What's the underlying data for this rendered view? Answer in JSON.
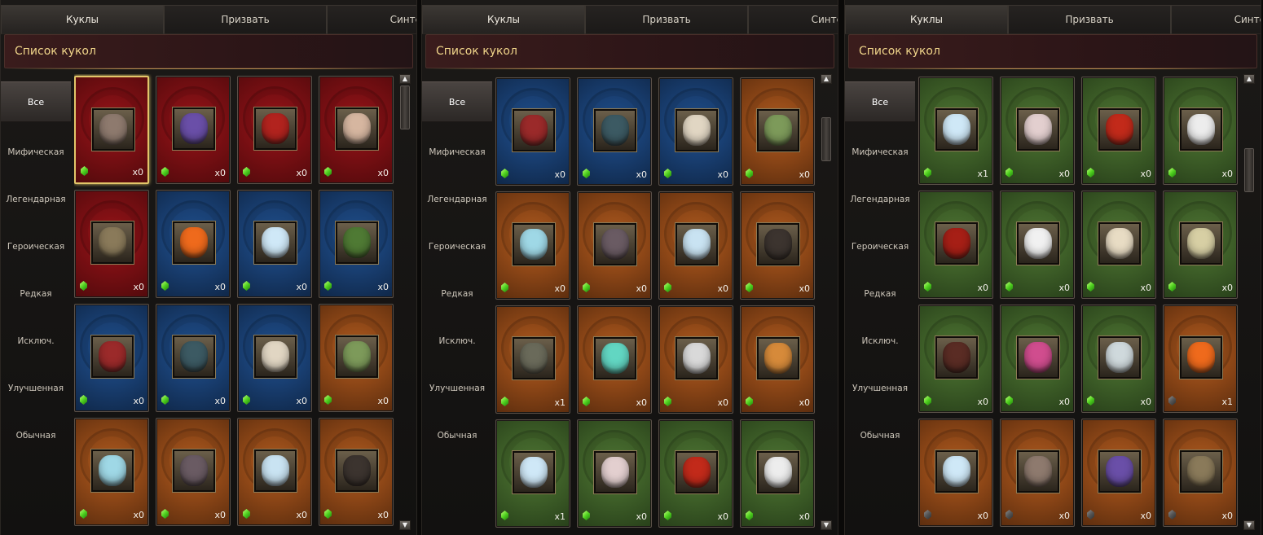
{
  "panels": [
    {
      "tabs": [
        "Куклы",
        "Призвать",
        "Синтез"
      ],
      "active_tab": 0,
      "header": "Список кукол",
      "categories": [
        "Все",
        "Мифическая",
        "Легендарная",
        "Героическая",
        "Редкая",
        "Исключ.",
        "Улучшенная",
        "Обычная"
      ],
      "active_category": 0,
      "scroll_thumb_fraction": 0.0,
      "cards": [
        {
          "rarity": "red",
          "count": "x0",
          "gem": "green",
          "selected": true,
          "face_color": "#8e7a6e"
        },
        {
          "rarity": "red",
          "count": "x0",
          "gem": "green",
          "face_color": "#6a4fa8"
        },
        {
          "rarity": "red",
          "count": "x0",
          "gem": "green",
          "face_color": "#b2231e"
        },
        {
          "rarity": "red",
          "count": "x0",
          "gem": "green",
          "face_color": "#d6b6a0"
        },
        {
          "rarity": "red",
          "count": "x0",
          "gem": "green",
          "face_color": "#8a7a5a"
        },
        {
          "rarity": "blue",
          "count": "x0",
          "gem": "green",
          "face_color": "#ef6a1c"
        },
        {
          "rarity": "blue",
          "count": "x0",
          "gem": "green",
          "face_color": "#cfe8f7"
        },
        {
          "rarity": "blue",
          "count": "x0",
          "gem": "green",
          "face_color": "#4f7a34"
        },
        {
          "rarity": "blue",
          "count": "x0",
          "gem": "green",
          "face_color": "#9b2a2a"
        },
        {
          "rarity": "blue",
          "count": "x0",
          "gem": "green",
          "face_color": "#3c5a63"
        },
        {
          "rarity": "blue",
          "count": "x0",
          "gem": "green",
          "face_color": "#e1d6c3"
        },
        {
          "rarity": "orange",
          "count": "x0",
          "gem": "green",
          "face_color": "#7d9a5a"
        },
        {
          "rarity": "orange",
          "count": "x0",
          "gem": "green",
          "face_color": "#9fd8e6"
        },
        {
          "rarity": "orange",
          "count": "x0",
          "gem": "green",
          "face_color": "#6a5b63"
        },
        {
          "rarity": "orange",
          "count": "x0",
          "gem": "green",
          "face_color": "#c9e3f2"
        },
        {
          "rarity": "orange",
          "count": "x0",
          "gem": "green",
          "face_color": "#3c342f"
        }
      ]
    },
    {
      "tabs": [
        "Куклы",
        "Призвать",
        "Синтез"
      ],
      "active_tab": 0,
      "header": "Список кукол",
      "categories": [
        "Все",
        "Мифическая",
        "Легендарная",
        "Героическая",
        "Редкая",
        "Исключ.",
        "Улучшенная",
        "Обычная"
      ],
      "active_category": 0,
      "scroll_thumb_fraction": 0.08,
      "cards": [
        {
          "rarity": "blue",
          "count": "x0",
          "gem": "green",
          "face_color": "#9b2a2a"
        },
        {
          "rarity": "blue",
          "count": "x0",
          "gem": "green",
          "face_color": "#3c5a63"
        },
        {
          "rarity": "blue",
          "count": "x0",
          "gem": "green",
          "face_color": "#e1d6c3"
        },
        {
          "rarity": "orange",
          "count": "x0",
          "gem": "green",
          "face_color": "#7d9a5a"
        },
        {
          "rarity": "orange",
          "count": "x0",
          "gem": "green",
          "face_color": "#9fd8e6"
        },
        {
          "rarity": "orange",
          "count": "x0",
          "gem": "green",
          "face_color": "#6a5b63"
        },
        {
          "rarity": "orange",
          "count": "x0",
          "gem": "green",
          "face_color": "#c9e3f2"
        },
        {
          "rarity": "orange",
          "count": "x0",
          "gem": "green",
          "face_color": "#3c342f"
        },
        {
          "rarity": "orange",
          "count": "x1",
          "gem": "green",
          "face_color": "#6a6a5a"
        },
        {
          "rarity": "orange",
          "count": "x0",
          "gem": "green",
          "face_color": "#62d6c2"
        },
        {
          "rarity": "orange",
          "count": "x0",
          "gem": "green",
          "face_color": "#d9d9d9"
        },
        {
          "rarity": "orange",
          "count": "x0",
          "gem": "green",
          "face_color": "#d68a3a"
        },
        {
          "rarity": "green",
          "count": "x1",
          "gem": "green",
          "face_color": "#cfe8f7"
        },
        {
          "rarity": "green",
          "count": "x0",
          "gem": "green",
          "face_color": "#e3cfcf"
        },
        {
          "rarity": "green",
          "count": "x0",
          "gem": "green",
          "face_color": "#c22a1a"
        },
        {
          "rarity": "green",
          "count": "x0",
          "gem": "green",
          "face_color": "#ededed"
        }
      ]
    },
    {
      "tabs": [
        "Куклы",
        "Призвать",
        "Синтез"
      ],
      "active_tab": 0,
      "header": "Список кукол",
      "categories": [
        "Все",
        "Мифическая",
        "Легендарная",
        "Героическая",
        "Редкая",
        "Исключ.",
        "Улучшенная",
        "Обычная"
      ],
      "active_category": 0,
      "scroll_thumb_fraction": 0.16,
      "cards": [
        {
          "rarity": "green",
          "count": "x1",
          "gem": "green",
          "face_color": "#cfe8f7"
        },
        {
          "rarity": "green",
          "count": "x0",
          "gem": "green",
          "face_color": "#e3cfcf"
        },
        {
          "rarity": "green",
          "count": "x0",
          "gem": "green",
          "face_color": "#c22a1a"
        },
        {
          "rarity": "green",
          "count": "x0",
          "gem": "green",
          "face_color": "#ededed"
        },
        {
          "rarity": "green",
          "count": "x0",
          "gem": "green",
          "face_color": "#a61f16"
        },
        {
          "rarity": "green",
          "count": "x0",
          "gem": "green",
          "face_color": "#f1f1f1"
        },
        {
          "rarity": "green",
          "count": "x0",
          "gem": "green",
          "face_color": "#e8dcc4"
        },
        {
          "rarity": "green",
          "count": "x0",
          "gem": "green",
          "face_color": "#d7cfa4"
        },
        {
          "rarity": "green",
          "count": "x0",
          "gem": "green",
          "face_color": "#5a2c24"
        },
        {
          "rarity": "green",
          "count": "x0",
          "gem": "green",
          "face_color": "#d04d8e"
        },
        {
          "rarity": "green",
          "count": "x0",
          "gem": "green",
          "face_color": "#cfd9dc"
        },
        {
          "rarity": "orange",
          "count": "x1",
          "gem": "gray",
          "face_color": "#ef6a1c"
        },
        {
          "rarity": "orange",
          "count": "x0",
          "gem": "gray",
          "face_color": "#cfe8f7"
        },
        {
          "rarity": "orange",
          "count": "x0",
          "gem": "gray",
          "face_color": "#8e7a6e"
        },
        {
          "rarity": "orange",
          "count": "x0",
          "gem": "gray",
          "face_color": "#6a4fa8"
        },
        {
          "rarity": "orange",
          "count": "x0",
          "gem": "gray",
          "face_color": "#8a7a5a"
        }
      ]
    }
  ]
}
